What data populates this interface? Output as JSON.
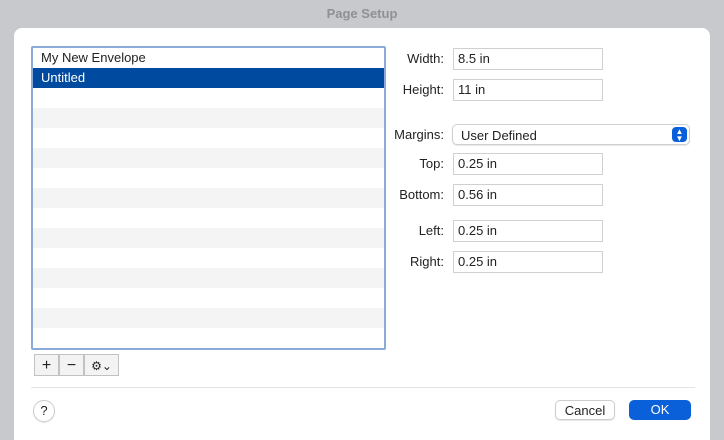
{
  "window": {
    "title": "Page Setup"
  },
  "list": {
    "items": [
      "My New Envelope",
      "Untitled"
    ],
    "selected": "Untitled"
  },
  "form": {
    "width_label": "Width:",
    "width": "8.5 in",
    "height_label": "Height:",
    "height": "11 in",
    "margins_label": "Margins:",
    "margins": "User Defined",
    "top_label": "Top:",
    "top": "0.25 in",
    "bottom_label": "Bottom:",
    "bottom": "0.56 in",
    "left_label": "Left:",
    "left": "0.25 in",
    "right_label": "Right:",
    "right": "0.25 in"
  },
  "toolbar": {
    "add": "+",
    "remove": "−",
    "action": "⚙⌄"
  },
  "footer": {
    "help": "?",
    "cancel": "Cancel",
    "ok": "OK"
  },
  "colors": {
    "accent": "#004aa0",
    "button": "#0a60d8"
  }
}
